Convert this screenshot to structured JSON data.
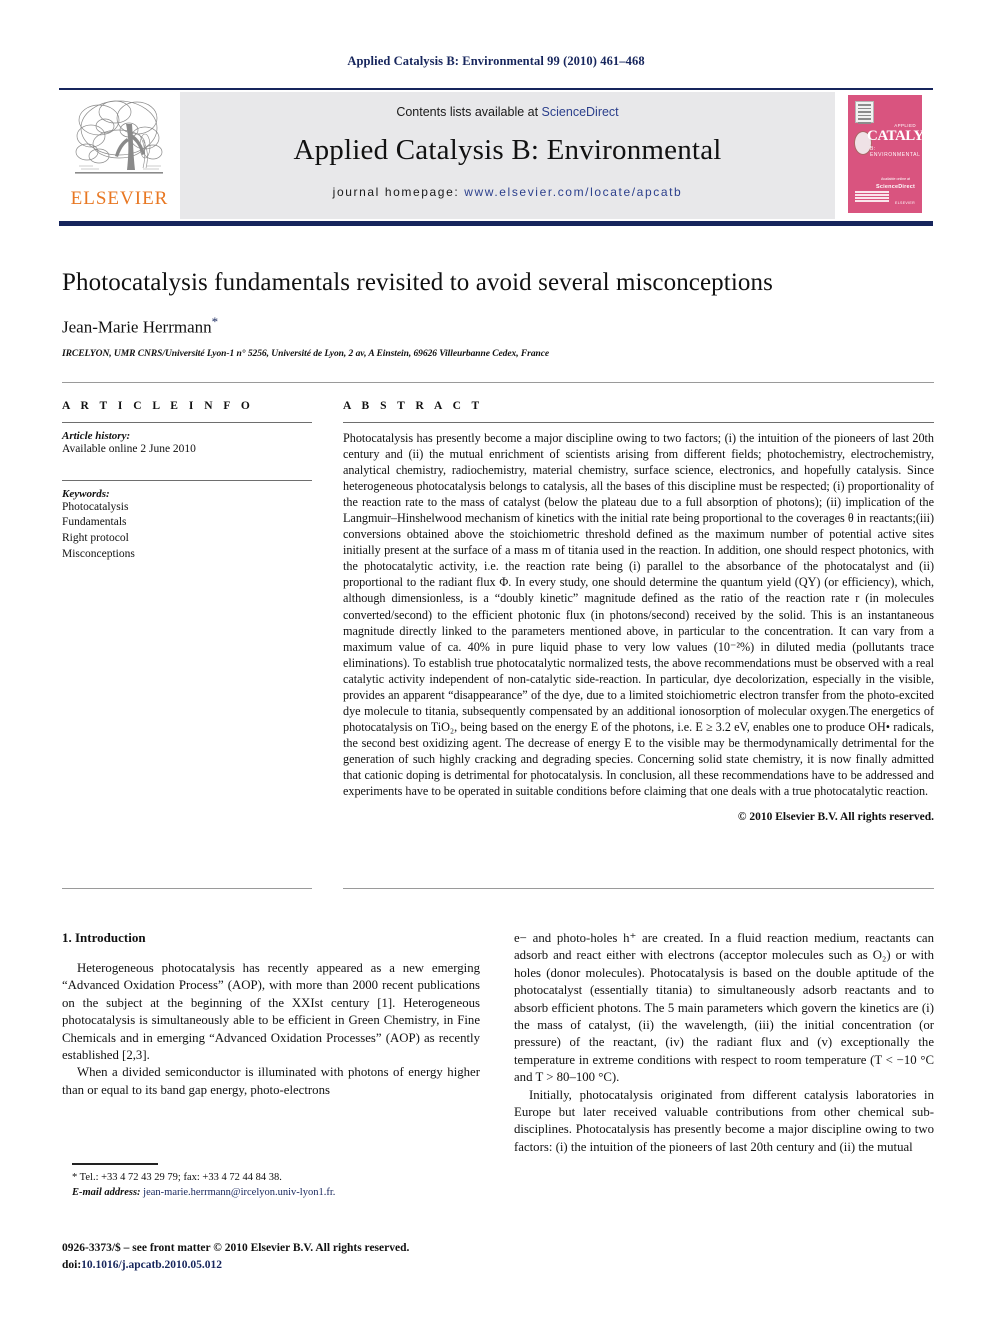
{
  "running_head": "Applied Catalysis B: Environmental 99 (2010) 461–468",
  "masthead": {
    "contents_prefix": "Contents lists available at ",
    "contents_link": "ScienceDirect",
    "journal_name": "Applied Catalysis B: Environmental",
    "homepage_prefix": "journal homepage: ",
    "homepage_url": "www.elsevier.com/locate/apcatb",
    "publisher_logo_text": "ELSEVIER",
    "cover": {
      "applied_label": "APPLIED",
      "title": "CATALYSIS",
      "subtitle": "B: ENVIRONMENTAL",
      "available_label": "Available online at",
      "sciencedirect": "ScienceDirect",
      "elsevier": "ELSEVIER",
      "accent_color": "#d9547f"
    }
  },
  "article": {
    "title": "Photocatalysis fundamentals revisited to avoid several misconceptions",
    "author": "Jean-Marie Herrmann",
    "author_marker": "*",
    "affiliation": "IRCELYON, UMR CNRS/Université Lyon-1 n° 5256, Université de Lyon, 2 av, A Einstein, 69626 Villeurbanne Cedex, France"
  },
  "article_info": {
    "heading": "A R T I C L E   I N F O",
    "history_label": "Article history:",
    "history_value": "Available online 2 June 2010",
    "keywords_label": "Keywords:",
    "keywords": [
      "Photocatalysis",
      "Fundamentals",
      "Right protocol",
      "Misconceptions"
    ]
  },
  "abstract": {
    "heading": "A B S T R A C T",
    "body": "Photocatalysis has presently become a major discipline owing to two factors; (i) the intuition of the pioneers of last 20th century and (ii) the mutual enrichment of scientists arising from different fields; photochemistry, electrochemistry, analytical chemistry, radiochemistry, material chemistry, surface science, electronics, and hopefully catalysis. Since heterogeneous photocatalysis belongs to catalysis, all the bases of this discipline must be respected; (i) proportionality of the reaction rate to the mass of catalyst (below the plateau due to a full absorption of photons); (ii) implication of the Langmuir–Hinshelwood mechanism of kinetics with the initial rate being proportional to the coverages θ in reactants;(iii) conversions obtained above the stoichiometric threshold defined as the maximum number of potential active sites initially present at the surface of a mass m of titania used in the reaction. In addition, one should respect photonics, with the photocatalytic activity, i.e. the reaction rate being (i) parallel to the absorbance of the photocatalyst and (ii) proportional to the radiant flux Φ. In every study, one should determine the quantum yield (QY) (or efficiency), which, although dimensionless, is a “doubly kinetic” magnitude defined as the ratio of the reaction rate r (in molecules converted/second) to the efficient photonic flux (in photons/second) received by the solid. This is an instantaneous magnitude directly linked to the parameters mentioned above, in particular to the concentration. It can vary from a maximum value of ca. 40% in pure liquid phase to very low values (10⁻²%) in diluted media (pollutants trace eliminations). To establish true photocatalytic normalized tests, the above recommendations must be observed with a real catalytic activity independent of non-catalytic side-reaction. In particular, dye decolorization, especially in the visible, provides an apparent “disappearance” of the dye, due to a limited stoichiometric electron transfer from the photo-excited dye molecule to titania, subsequently compensated by an additional ionosorption of molecular oxygen.The energetics of photocatalysis on TiO₂, being based on the energy E of the photons, i.e. E ≥ 3.2 eV, enables one to produce OH• radicals, the second best oxidizing agent. The decrease of energy E to the visible may be thermodynamically detrimental for the generation of such highly cracking and degrading species. Concerning solid state chemistry, it is now finally admitted that cationic doping is detrimental for photocatalysis. In conclusion, all these recommendations have to be addressed and experiments have to be operated in suitable conditions before claiming that one deals with a true photocatalytic reaction.",
    "copyright": "© 2010 Elsevier B.V. All rights reserved."
  },
  "body": {
    "section_number_title": "1.  Introduction",
    "left_paragraphs": [
      "Heterogeneous photocatalysis has recently appeared as a new emerging “Advanced Oxidation Process” (AOP), with more than 2000 recent publications on the subject at the beginning of the XXIst century [1]. Heterogeneous photocatalysis is simultaneously able to be efficient in Green Chemistry, in Fine Chemicals and in emerging “Advanced Oxidation Processes” (AOP) as recently established [2,3].",
      "When a divided semiconductor is illuminated with photons of energy higher than or equal to its band gap energy, photo-electrons"
    ],
    "right_paragraphs": [
      "e− and photo-holes h⁺ are created. In a fluid reaction medium, reactants can adsorb and react either with electrons (acceptor molecules such as O₂) or with holes (donor molecules). Photocatalysis is based on the double aptitude of the photocatalyst (essentially titania) to simultaneously adsorb reactants and to absorb efficient photons. The 5 main parameters which govern the kinetics are (i) the mass of catalyst, (ii) the wavelength, (iii) the initial concentration (or pressure) of the reactant, (iv) the radiant flux and (v) exceptionally the temperature in extreme conditions with respect to room temperature (T < −10 °C and T > 80–100 °C).",
      "Initially, photocatalysis originated from different catalysis laboratories in Europe but later received valuable contributions from other chemical sub-disciplines. Photocatalysis has presently become a major discipline owing to two factors: (i) the intuition of the pioneers of last 20th century and (ii) the mutual"
    ]
  },
  "footnotes": {
    "tel_line": "* Tel.: +33 4 72 43 29 79; fax: +33 4 72 44 84 38.",
    "email_label": "E-mail address:",
    "email_value": "jean-marie.herrmann@ircelyon.univ-lyon1.fr."
  },
  "colophon": {
    "front_matter": "0926-3373/$ – see front matter © 2010 Elsevier B.V. All rights reserved.",
    "doi_label": "doi:",
    "doi_value": "10.1016/j.apcatb.2010.05.012"
  }
}
